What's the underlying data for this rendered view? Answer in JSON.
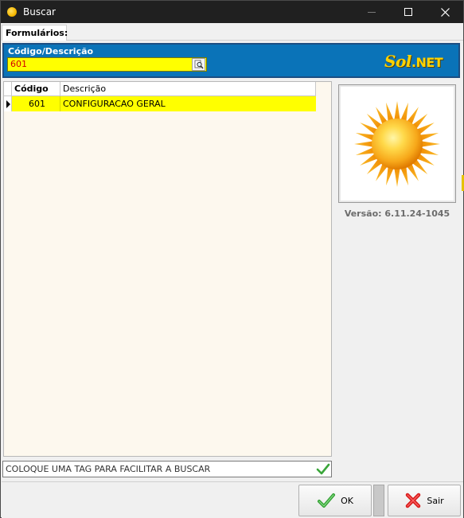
{
  "window": {
    "title": "Buscar",
    "icons": {
      "app": "sun-icon",
      "minimize": "minimize-icon",
      "maximize": "maximize-icon",
      "close": "close-icon"
    }
  },
  "tabs": [
    {
      "label": "Formulários:"
    }
  ],
  "search": {
    "label": "Código/Descrição",
    "value": "601",
    "button_icon": "search-icon"
  },
  "logo": {
    "part1": "Sol",
    "part2": ".NET"
  },
  "grid": {
    "columns": [
      "Código",
      "Descrição"
    ],
    "rows": [
      {
        "code": "601",
        "description": "CONFIGURACAO GERAL",
        "selected": true
      }
    ]
  },
  "side_panel": {
    "image": "sun-icon",
    "version": "Versão: 6.11.24-1045"
  },
  "tag": {
    "value": "COLOQUE UMA TAG PARA FACILITAR A BUSCAR",
    "icon": "checkmark-icon"
  },
  "buttons": {
    "ok": {
      "label": "OK",
      "icon": "checkmark-icon"
    },
    "sair": {
      "label": "Sair",
      "icon": "x-icon"
    }
  },
  "colors": {
    "header_blue": "#0a73b8",
    "highlight_yellow": "#ffff00",
    "logo_gold": "#ffd200",
    "input_text_red": "#d40000"
  }
}
